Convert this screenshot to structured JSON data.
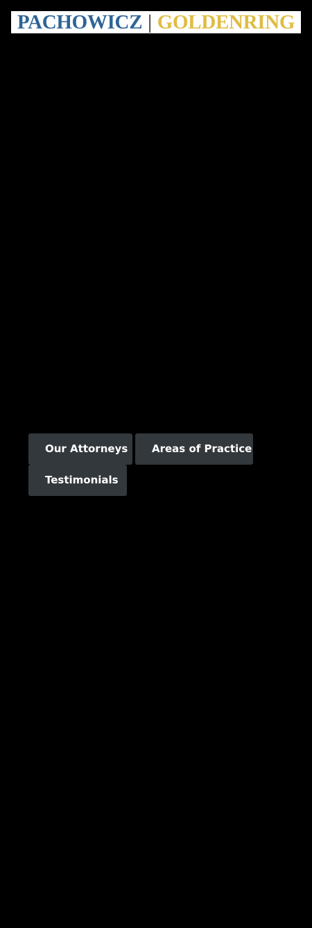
{
  "header": {
    "logo": {
      "part1": "PACHOWICZ",
      "separator": "|",
      "part2": "GOLDENRING",
      "colors": {
        "part1": "#2f6496",
        "part2": "#dfbc44"
      }
    }
  },
  "nav": {
    "buttons": [
      {
        "label": "Our Attorneys"
      },
      {
        "label": "Areas of Practice"
      },
      {
        "label": "Testimonials"
      }
    ],
    "button_color": "#33383c"
  },
  "page": {
    "background_color": "#000000"
  }
}
